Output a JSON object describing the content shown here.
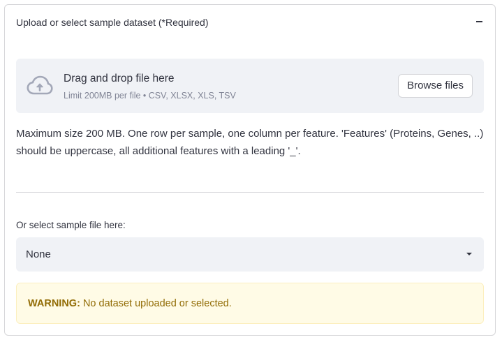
{
  "expander": {
    "title": "Upload or select sample dataset (*Required)",
    "collapse_icon": "minus-icon"
  },
  "uploader": {
    "icon": "cloud-upload-icon",
    "title": "Drag and drop file here",
    "limit_text": "Limit 200MB per file • CSV, XLSX, XLS, TSV",
    "browse_label": "Browse files"
  },
  "help_text": "Maximum size 200 MB. One row per sample, one column per feature. 'Features' (Proteins, Genes, ..) should be uppercase, all additional features with a leading '_'.",
  "sample_select": {
    "label": "Or select sample file here:",
    "value": "None",
    "icon": "chevron-down-icon"
  },
  "warning": {
    "prefix": "WARNING:",
    "message": "No dataset uploaded or selected.",
    "colors": {
      "background": "#fffbe6",
      "text": "#926c05"
    }
  },
  "colors": {
    "panel_background": "#f0f2f6",
    "border": "#d6d6d9",
    "text": "#31333f",
    "muted_text": "#808495",
    "icon": "#a3a8b8"
  }
}
